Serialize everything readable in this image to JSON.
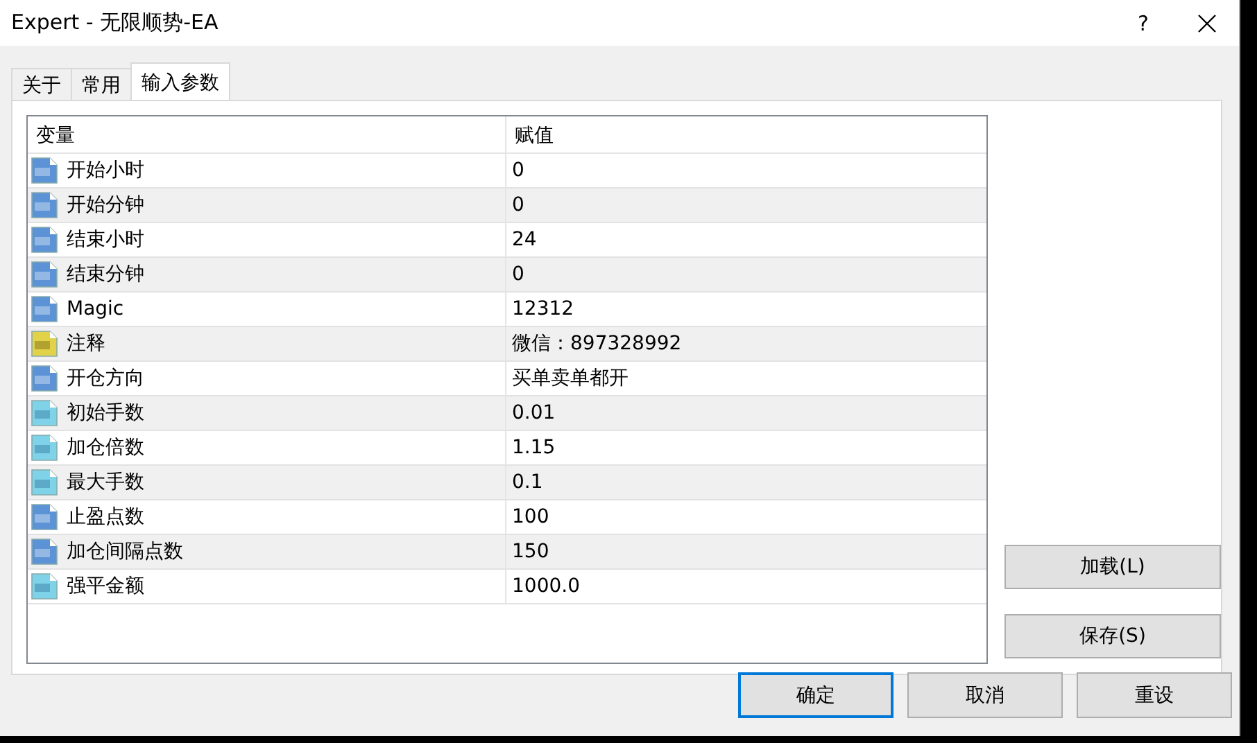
{
  "window": {
    "title": "Expert - 无限顺势-EA",
    "help": "?"
  },
  "tabs": [
    {
      "label": "关于",
      "selected": false
    },
    {
      "label": "常用",
      "selected": false
    },
    {
      "label": "输入参数",
      "selected": true
    }
  ],
  "table": {
    "columns": [
      "变量",
      "赋值"
    ],
    "rows": [
      {
        "kind": "int",
        "name": "开始小时",
        "value": "0"
      },
      {
        "kind": "int",
        "name": "开始分钟",
        "value": "0"
      },
      {
        "kind": "int",
        "name": "结束小时",
        "value": "24"
      },
      {
        "kind": "int",
        "name": "结束分钟",
        "value": "0"
      },
      {
        "kind": "int",
        "name": "Magic",
        "value": "12312"
      },
      {
        "kind": "string",
        "name": "注释",
        "value": "微信：897328992"
      },
      {
        "kind": "int",
        "name": "开仓方向",
        "value": "买单卖单都开"
      },
      {
        "kind": "double",
        "name": "初始手数",
        "value": "0.01"
      },
      {
        "kind": "double",
        "name": "加仓倍数",
        "value": "1.15"
      },
      {
        "kind": "double",
        "name": "最大手数",
        "value": "0.1"
      },
      {
        "kind": "int",
        "name": "止盈点数",
        "value": "100"
      },
      {
        "kind": "int",
        "name": "加仓间隔点数",
        "value": "150"
      },
      {
        "kind": "double",
        "name": "强平金额",
        "value": "1000.0"
      }
    ]
  },
  "side_buttons": [
    "加载(L)",
    "保存(S)"
  ],
  "buttons": [
    {
      "label": "确定",
      "default": true
    },
    {
      "label": "取消",
      "default": false
    },
    {
      "label": "重设",
      "default": false
    }
  ]
}
